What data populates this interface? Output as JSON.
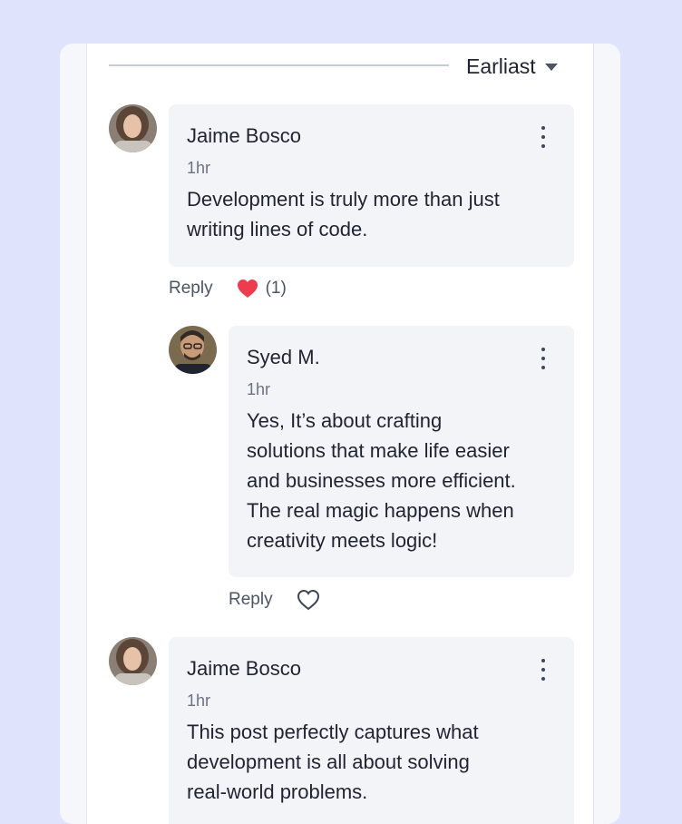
{
  "sort": {
    "label": "Earliast"
  },
  "comments": [
    {
      "author": "Jaime Bosco",
      "time": "1hr",
      "text_lines": [
        "Development is truly more than just",
        "writing lines of code."
      ],
      "reply_label": "Reply",
      "likes": "(1)",
      "liked": true
    },
    {
      "author": "Syed M.",
      "time": "1hr",
      "text_lines": [
        "Yes, It’s about crafting",
        "solutions that make life easier",
        "and businesses more efficient.",
        "The real magic happens when",
        "creativity meets logic!"
      ],
      "reply_label": "Reply",
      "liked": false
    },
    {
      "author": "Jaime Bosco",
      "time": "1hr",
      "text_lines": [
        "This post perfectly captures what",
        "development is all about solving",
        "real-world problems."
      ]
    }
  ],
  "colors": {
    "heart_filled": "#ef3b4e",
    "bubble_bg": "#f3f4f8",
    "page_bg": "#dfe3fb"
  },
  "icons": {
    "more": "kebab-menu-icon",
    "like_filled": "heart-filled-icon",
    "like_outline": "heart-outline-icon",
    "sort": "caret-down-icon"
  }
}
